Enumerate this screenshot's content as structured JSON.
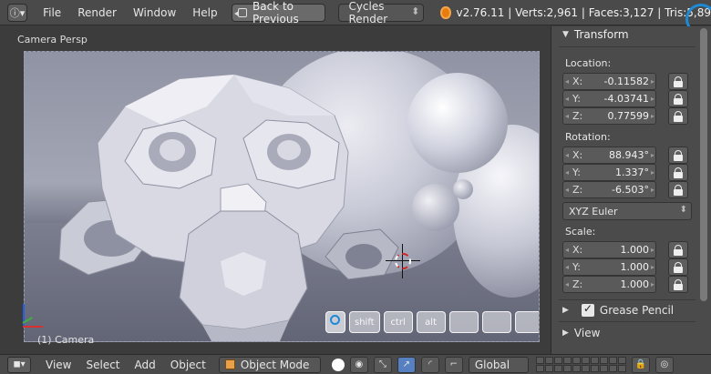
{
  "topbar": {
    "menus": [
      "File",
      "Render",
      "Window",
      "Help"
    ],
    "back_label": "Back to Previous",
    "engine": "Cycles Render",
    "stats": "v2.76.11 | Verts:2,961 | Faces:3,127 | Tris:5,89"
  },
  "viewport": {
    "view_label": "Camera Persp",
    "object_label": "(1) Camera",
    "keys": [
      "",
      "shift",
      "ctrl",
      "alt",
      "",
      "",
      ""
    ]
  },
  "panel": {
    "transform_title": "Transform",
    "location_label": "Location:",
    "location": [
      {
        "axis": "X:",
        "value": "-0.11582"
      },
      {
        "axis": "Y:",
        "value": "-4.03741"
      },
      {
        "axis": "Z:",
        "value": "0.77599"
      }
    ],
    "rotation_label": "Rotation:",
    "rotation": [
      {
        "axis": "X:",
        "value": "88.943°"
      },
      {
        "axis": "Y:",
        "value": "1.337°"
      },
      {
        "axis": "Z:",
        "value": "-6.503°"
      }
    ],
    "rotation_mode": "XYZ Euler",
    "scale_label": "Scale:",
    "scale": [
      {
        "axis": "X:",
        "value": "1.000"
      },
      {
        "axis": "Y:",
        "value": "1.000"
      },
      {
        "axis": "Z:",
        "value": "1.000"
      }
    ],
    "grease_pencil": "Grease Pencil",
    "view": "View"
  },
  "bottombar": {
    "menus": [
      "View",
      "Select",
      "Add",
      "Object"
    ],
    "mode": "Object Mode",
    "orientation": "Global"
  },
  "colors": {
    "accent_blue": "#1e8ad6",
    "blender_orange": "#e87d0d",
    "cursor_red": "#d02424"
  }
}
